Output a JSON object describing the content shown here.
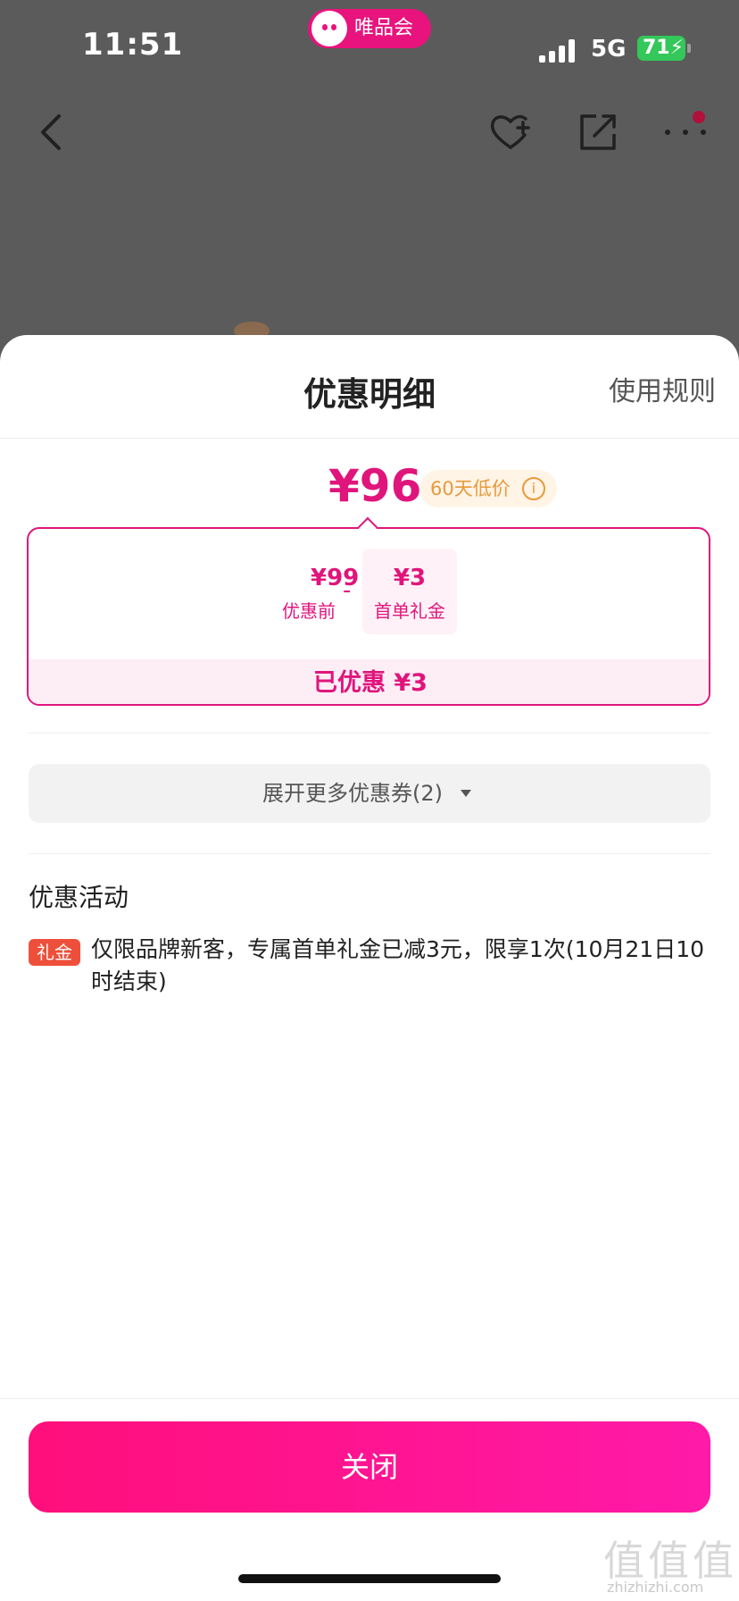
{
  "status_bar": {
    "time": "11:51",
    "app_name": "唯品会",
    "network": "5G",
    "battery": "71"
  },
  "nav": {
    "back_icon": "chevron-left-icon",
    "favorite_icon": "heart-plus-icon",
    "share_icon": "share-icon",
    "more_icon": "ellipsis-icon"
  },
  "sheet": {
    "title": "优惠明细",
    "rules_link": "使用规则",
    "final_price": "¥96",
    "low_price_badge": "60天低价",
    "breakdown": {
      "original_amount": "¥99",
      "original_label": "优惠前",
      "minus": "-",
      "coupon_amount": "¥3",
      "coupon_label": "首单礼金",
      "saved": "已优惠 ¥3"
    },
    "expand_button": "展开更多优惠券(2)",
    "section_title": "优惠活动",
    "promo_tag": "礼金",
    "promo_text": "仅限品牌新客，专属首单礼金已减3元，限享1次(10月21日10时结束)",
    "close_button": "关闭"
  },
  "watermark": {
    "text": "值值值",
    "sub": "zhizhizhi.com"
  },
  "colors": {
    "accent": "#e0157c",
    "button_gradient_start": "#ff0f7b",
    "button_gradient_end": "#ff1aa8",
    "gift_tag": "#ee4f3a",
    "low_price_badge_text": "#e89a3c",
    "battery_green": "#34c759",
    "backdrop": "#5b5b5b"
  }
}
